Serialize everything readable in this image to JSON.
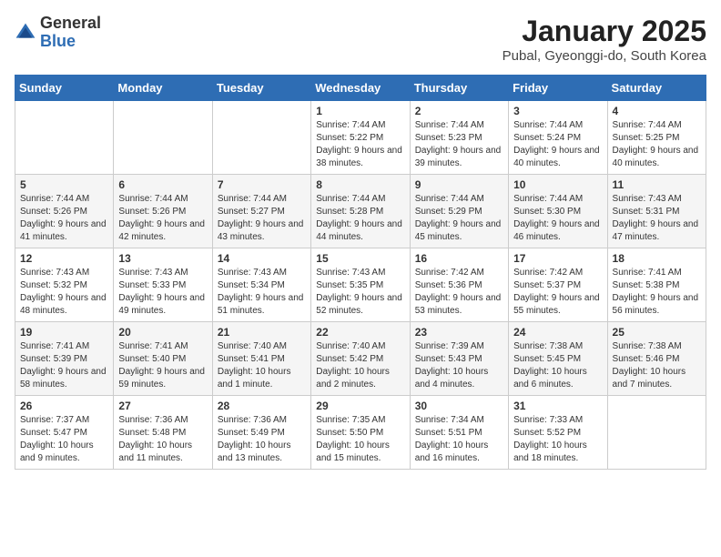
{
  "header": {
    "logo": {
      "line1": "General",
      "line2": "Blue"
    },
    "title": "January 2025",
    "location": "Pubal, Gyeonggi-do, South Korea"
  },
  "weekdays": [
    "Sunday",
    "Monday",
    "Tuesday",
    "Wednesday",
    "Thursday",
    "Friday",
    "Saturday"
  ],
  "weeks": [
    [
      {
        "day": "",
        "empty": true
      },
      {
        "day": "",
        "empty": true
      },
      {
        "day": "",
        "empty": true
      },
      {
        "day": "1",
        "sunrise": "7:44 AM",
        "sunset": "5:22 PM",
        "daylight": "9 hours and 38 minutes."
      },
      {
        "day": "2",
        "sunrise": "7:44 AM",
        "sunset": "5:23 PM",
        "daylight": "9 hours and 39 minutes."
      },
      {
        "day": "3",
        "sunrise": "7:44 AM",
        "sunset": "5:24 PM",
        "daylight": "9 hours and 40 minutes."
      },
      {
        "day": "4",
        "sunrise": "7:44 AM",
        "sunset": "5:25 PM",
        "daylight": "9 hours and 40 minutes."
      }
    ],
    [
      {
        "day": "5",
        "sunrise": "7:44 AM",
        "sunset": "5:26 PM",
        "daylight": "9 hours and 41 minutes."
      },
      {
        "day": "6",
        "sunrise": "7:44 AM",
        "sunset": "5:26 PM",
        "daylight": "9 hours and 42 minutes."
      },
      {
        "day": "7",
        "sunrise": "7:44 AM",
        "sunset": "5:27 PM",
        "daylight": "9 hours and 43 minutes."
      },
      {
        "day": "8",
        "sunrise": "7:44 AM",
        "sunset": "5:28 PM",
        "daylight": "9 hours and 44 minutes."
      },
      {
        "day": "9",
        "sunrise": "7:44 AM",
        "sunset": "5:29 PM",
        "daylight": "9 hours and 45 minutes."
      },
      {
        "day": "10",
        "sunrise": "7:44 AM",
        "sunset": "5:30 PM",
        "daylight": "9 hours and 46 minutes."
      },
      {
        "day": "11",
        "sunrise": "7:43 AM",
        "sunset": "5:31 PM",
        "daylight": "9 hours and 47 minutes."
      }
    ],
    [
      {
        "day": "12",
        "sunrise": "7:43 AM",
        "sunset": "5:32 PM",
        "daylight": "9 hours and 48 minutes."
      },
      {
        "day": "13",
        "sunrise": "7:43 AM",
        "sunset": "5:33 PM",
        "daylight": "9 hours and 49 minutes."
      },
      {
        "day": "14",
        "sunrise": "7:43 AM",
        "sunset": "5:34 PM",
        "daylight": "9 hours and 51 minutes."
      },
      {
        "day": "15",
        "sunrise": "7:43 AM",
        "sunset": "5:35 PM",
        "daylight": "9 hours and 52 minutes."
      },
      {
        "day": "16",
        "sunrise": "7:42 AM",
        "sunset": "5:36 PM",
        "daylight": "9 hours and 53 minutes."
      },
      {
        "day": "17",
        "sunrise": "7:42 AM",
        "sunset": "5:37 PM",
        "daylight": "9 hours and 55 minutes."
      },
      {
        "day": "18",
        "sunrise": "7:41 AM",
        "sunset": "5:38 PM",
        "daylight": "9 hours and 56 minutes."
      }
    ],
    [
      {
        "day": "19",
        "sunrise": "7:41 AM",
        "sunset": "5:39 PM",
        "daylight": "9 hours and 58 minutes."
      },
      {
        "day": "20",
        "sunrise": "7:41 AM",
        "sunset": "5:40 PM",
        "daylight": "9 hours and 59 minutes."
      },
      {
        "day": "21",
        "sunrise": "7:40 AM",
        "sunset": "5:41 PM",
        "daylight": "10 hours and 1 minute."
      },
      {
        "day": "22",
        "sunrise": "7:40 AM",
        "sunset": "5:42 PM",
        "daylight": "10 hours and 2 minutes."
      },
      {
        "day": "23",
        "sunrise": "7:39 AM",
        "sunset": "5:43 PM",
        "daylight": "10 hours and 4 minutes."
      },
      {
        "day": "24",
        "sunrise": "7:38 AM",
        "sunset": "5:45 PM",
        "daylight": "10 hours and 6 minutes."
      },
      {
        "day": "25",
        "sunrise": "7:38 AM",
        "sunset": "5:46 PM",
        "daylight": "10 hours and 7 minutes."
      }
    ],
    [
      {
        "day": "26",
        "sunrise": "7:37 AM",
        "sunset": "5:47 PM",
        "daylight": "10 hours and 9 minutes."
      },
      {
        "day": "27",
        "sunrise": "7:36 AM",
        "sunset": "5:48 PM",
        "daylight": "10 hours and 11 minutes."
      },
      {
        "day": "28",
        "sunrise": "7:36 AM",
        "sunset": "5:49 PM",
        "daylight": "10 hours and 13 minutes."
      },
      {
        "day": "29",
        "sunrise": "7:35 AM",
        "sunset": "5:50 PM",
        "daylight": "10 hours and 15 minutes."
      },
      {
        "day": "30",
        "sunrise": "7:34 AM",
        "sunset": "5:51 PM",
        "daylight": "10 hours and 16 minutes."
      },
      {
        "day": "31",
        "sunrise": "7:33 AM",
        "sunset": "5:52 PM",
        "daylight": "10 hours and 18 minutes."
      },
      {
        "day": "",
        "empty": true
      }
    ]
  ],
  "labels": {
    "sunrise_prefix": "Sunrise: ",
    "sunset_prefix": "Sunset: ",
    "daylight_prefix": "Daylight: "
  }
}
